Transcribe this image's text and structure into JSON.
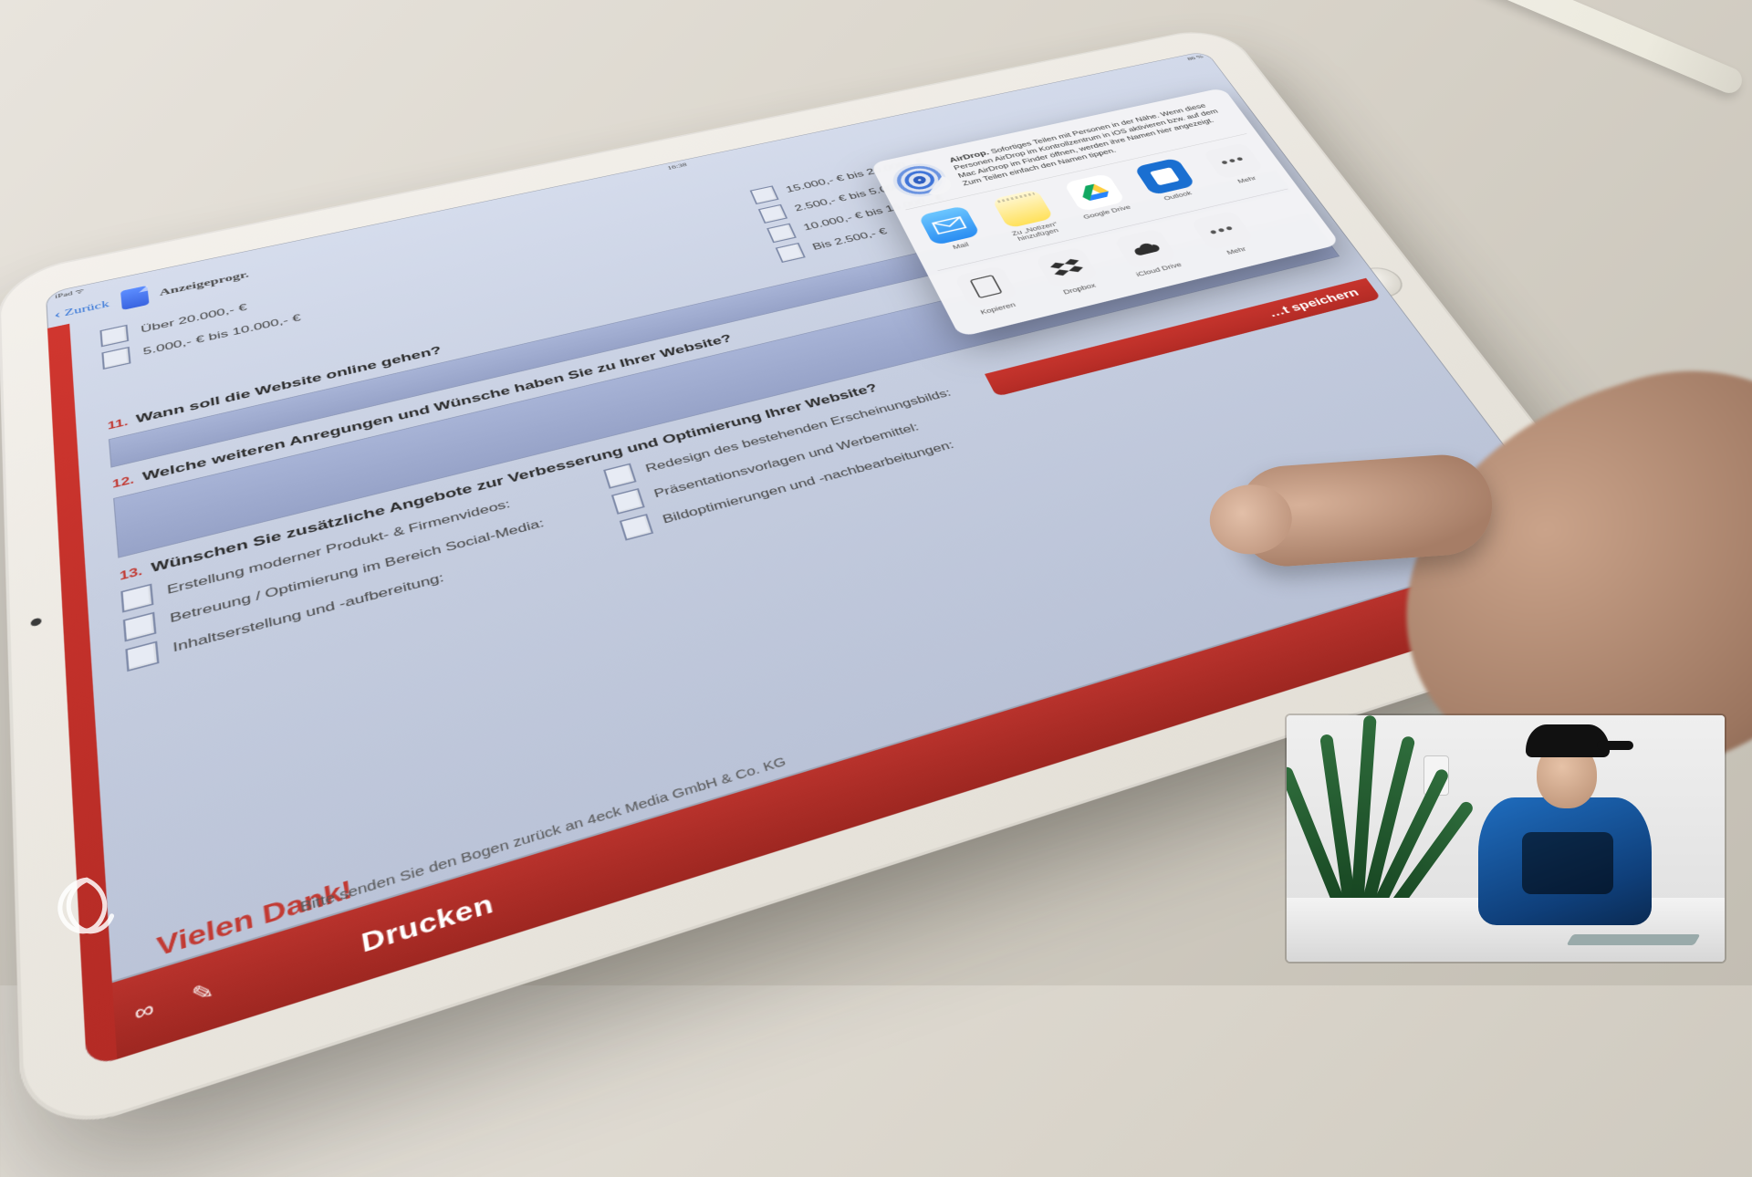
{
  "status": {
    "left": "iPad ᯤ",
    "time": "16:38",
    "right": "86 %"
  },
  "nav": {
    "back": "Zurück",
    "title": "Anzeigeprogr."
  },
  "budget_options_left": [
    "Über 20.000,- €",
    "5.000,- € bis 10.000,- €"
  ],
  "budget_options_right": [
    "15.000,- € bis 20.000,- €",
    "2.500,- € bis 5.000,- €",
    "10.000,- € bis 15.000,- €",
    "Bis 2.500,- €"
  ],
  "q11": {
    "num": "11.",
    "text": "Wann soll die Website online gehen?"
  },
  "q12": {
    "num": "12.",
    "text": "Welche weiteren Anregungen und Wünsche haben Sie zu Ihrer Website?"
  },
  "q13": {
    "num": "13.",
    "text": "Wünschen Sie zusätzliche Angebote zur Verbesserung und Optimierung Ihrer Website?",
    "opts": [
      "Erstellung moderner Produkt- & Firmenvideos:",
      "Betreuung / Optimierung im Bereich Social-Media:",
      "Inhaltserstellung und -aufbereitung:",
      "Redesign des bestehenden Erscheinungsbilds:",
      "Präsentationsvorlagen und Werbemittel:",
      "Bildoptimierungen und -nachbearbeitungen:"
    ]
  },
  "thanks": "Vielen Dank!",
  "footer": "Bitte senden Sie den Bogen zurück an 4eck Media GmbH & Co. KG",
  "action": {
    "label": "Drucken"
  },
  "sheet": {
    "airdrop_title": "AirDrop.",
    "airdrop_body": "Sofortiges Teilen mit Personen in der Nähe. Wenn diese Personen AirDrop im Kontrollzentrum in iOS aktivieren bzw. auf dem Mac AirDrop im Finder öffnen, werden ihre Namen hier angezeigt. Zum Teilen einfach den Namen tippen.",
    "apps": [
      {
        "name": "Mail",
        "icon": "mail"
      },
      {
        "name": "Zu „Notizen“ hinzufügen",
        "icon": "notes"
      },
      {
        "name": "Google Drive",
        "icon": "drive"
      },
      {
        "name": "Outlook",
        "icon": "outlook"
      },
      {
        "name": "Mehr",
        "icon": "more"
      }
    ],
    "actions": [
      {
        "name": "Kopieren",
        "icon": "copy"
      },
      {
        "name": "Dropbox",
        "icon": "db"
      },
      {
        "name": "iCloud Drive",
        "icon": "cloud"
      },
      {
        "name": "Mehr",
        "icon": "more"
      }
    ]
  },
  "red_peek": "…t speichern"
}
